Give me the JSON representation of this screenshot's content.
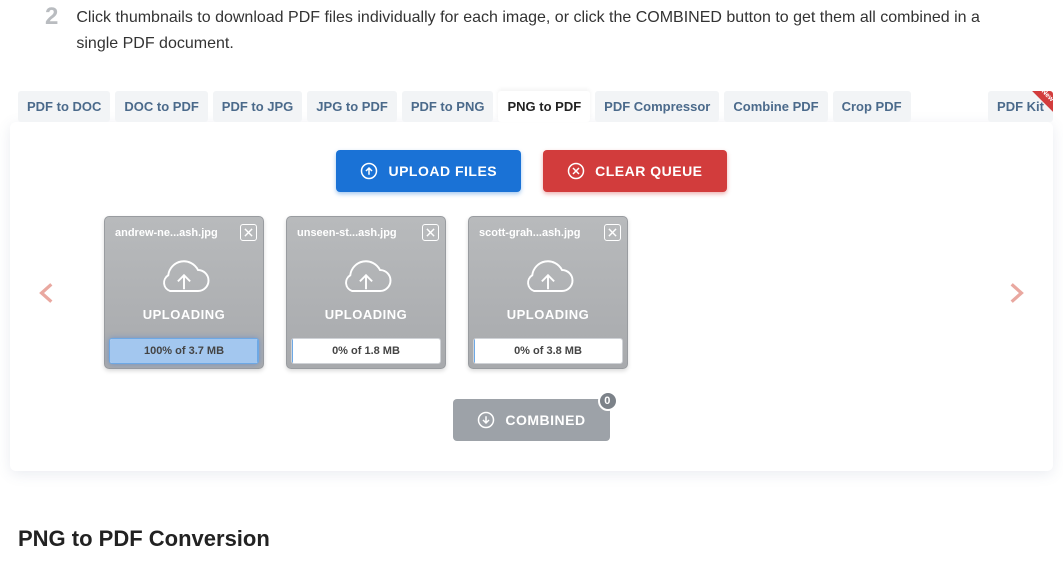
{
  "step": {
    "number": "2",
    "text": "Click thumbnails to download PDF files individually for each image, or click the COMBINED button to get them all combined in a single PDF document."
  },
  "tabs": [
    {
      "label": "PDF to DOC",
      "active": false
    },
    {
      "label": "DOC to PDF",
      "active": false
    },
    {
      "label": "PDF to JPG",
      "active": false
    },
    {
      "label": "JPG to PDF",
      "active": false
    },
    {
      "label": "PDF to PNG",
      "active": false
    },
    {
      "label": "PNG to PDF",
      "active": true
    },
    {
      "label": "PDF Compressor",
      "active": false
    },
    {
      "label": "Combine PDF",
      "active": false
    },
    {
      "label": "Crop PDF",
      "active": false
    }
  ],
  "kit_tab": {
    "label": "PDF Kit",
    "badge": "New"
  },
  "buttons": {
    "upload": "UPLOAD FILES",
    "clear": "CLEAR QUEUE",
    "combined": "COMBINED",
    "combined_count": "0"
  },
  "files": [
    {
      "name": "andrew-ne...ash.jpg",
      "status": "UPLOADING",
      "progress_pct": 100,
      "label": "100% of 3.7 MB"
    },
    {
      "name": "unseen-st...ash.jpg",
      "status": "UPLOADING",
      "progress_pct": 0,
      "label": "0% of 1.8 MB"
    },
    {
      "name": "scott-grah...ash.jpg",
      "status": "UPLOADING",
      "progress_pct": 0,
      "label": "0% of 3.8 MB"
    }
  ],
  "section_heading": "PNG to PDF Conversion"
}
